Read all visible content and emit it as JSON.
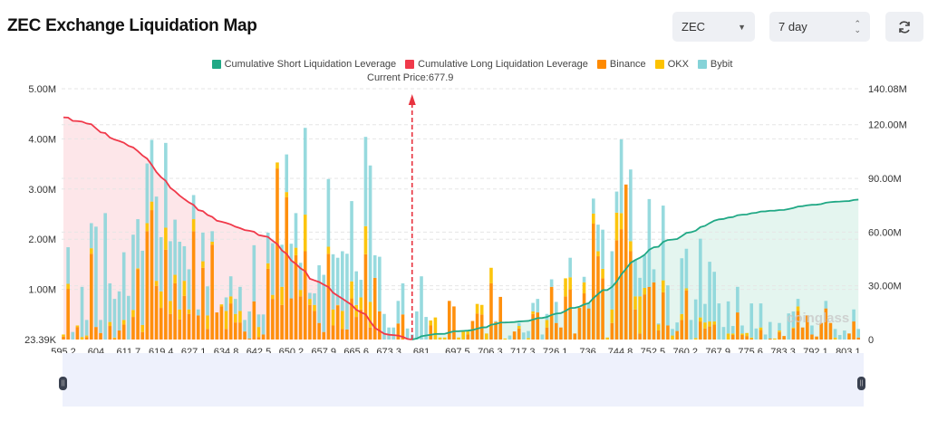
{
  "header": {
    "title": "ZEC Exchange Liquidation Map",
    "coin_select": {
      "value": "ZEC",
      "icon": "caret-down-icon"
    },
    "range_select": {
      "value": "7 day",
      "icon": "up-down-chevron-icon"
    },
    "refresh_icon": "refresh-icon"
  },
  "watermark": "coinglass",
  "slider": {
    "start": 0,
    "end": 1
  },
  "chart_data": {
    "type": "bar",
    "stacked": true,
    "current_price_label": "Current Price:677.9",
    "current_price": 677.9,
    "legend": [
      {
        "name": "Cumulative Short Liquidation Leverage",
        "color": "#20a885"
      },
      {
        "name": "Cumulative Long Liquidation Leverage",
        "color": "#f0394a"
      },
      {
        "name": "Binance",
        "color": "#ff8a00"
      },
      {
        "name": "OKX",
        "color": "#fcc200"
      },
      {
        "name": "Bybit",
        "color": "#85d3d8"
      }
    ],
    "legend_position": "top",
    "grid": true,
    "x_tick_labels": [
      "595.2",
      "604",
      "611.7",
      "619.4",
      "627.1",
      "634.8",
      "642.5",
      "650.2",
      "657.9",
      "665.6",
      "673.3",
      "681",
      "697.5",
      "706.3",
      "717.3",
      "726.1",
      "736",
      "744.8",
      "752.5",
      "760.2",
      "767.9",
      "775.6",
      "783.3",
      "792.1",
      "803.1"
    ],
    "y_left": {
      "ticks": [
        "23.39K",
        "1.00M",
        "2.00M",
        "3.00M",
        "4.00M",
        "5.00M"
      ],
      "range_millions": [
        0,
        5
      ]
    },
    "y_right": {
      "ticks": [
        "0",
        "30.00M",
        "60.00M",
        "90.00M",
        "120.00M",
        "140.08M"
      ],
      "range_millions": [
        0,
        140.08
      ]
    },
    "units": "millions USD",
    "current_price_bar_index": 75,
    "series": [
      {
        "name": "Binance",
        "values": [
          0.06,
          1.01,
          0,
          0.25,
          0,
          0.05,
          1.71,
          0.25,
          0.13,
          0,
          0.27,
          0.02,
          0.18,
          0.3,
          0,
          0.45,
          1.4,
          0.15,
          2.16,
          2.58,
          1.07,
          0.63,
          1.79,
          0.51,
          1.12,
          0.4,
          0.87,
          0.51,
          2.16,
          0.48,
          1.43,
          0.21,
          1.89,
          0.54,
          0.66,
          0.21,
          0.72,
          0.34,
          0.34,
          0.16,
          0.02,
          0.76,
          0.05,
          0.1,
          1.41,
          0.81,
          3.41,
          0.69,
          2.84,
          0.82,
          1.68,
          0.86,
          1.76,
          0.69,
          0.57,
          0.33,
          0.15,
          1.71,
          0.28,
          0.68,
          0.21,
          0.2,
          0.82,
          0.45,
          0.6,
          1.7,
          0.24,
          1.23,
          0.56,
          0,
          0,
          0,
          0.32,
          0.5,
          0,
          0,
          0,
          0,
          0,
          0.28,
          0,
          0,
          0,
          0.77,
          0.66,
          0,
          0,
          0.1,
          0.37,
          0.52,
          0.5,
          0,
          1.12,
          0.35,
          0.85,
          0,
          0,
          0.16,
          0.22,
          0,
          0,
          0.51,
          0.54,
          0,
          0.24,
          1.05,
          0.33,
          0.24,
          0.86,
          1.0,
          0.12,
          0.63,
          0.92,
          0.62,
          2.31,
          1.66,
          1.22,
          0,
          0.33,
          1.98,
          2.2,
          3.09,
          1.76,
          0.6,
          0.12,
          0.9,
          1.05,
          1.14,
          0.18,
          0.94,
          0.28,
          0,
          0.17,
          0.39,
          0.98,
          0,
          0,
          0.36,
          0.22,
          0.26,
          0.3,
          0,
          0,
          0,
          0.09,
          0.54,
          0.09,
          0.07,
          0.02,
          0,
          0.19,
          0,
          0.02,
          0,
          0.15,
          0.07,
          0,
          0.22,
          0.57,
          0.24,
          0.48,
          0.1,
          0.06,
          0.33,
          0.62,
          0.33,
          0,
          0,
          0,
          0.12,
          0.36,
          0.04
        ]
      },
      {
        "name": "OKX",
        "values": [
          0.04,
          0.1,
          0,
          0.03,
          0.05,
          0.03,
          0.11,
          0,
          0,
          0,
          0.08,
          0.02,
          0,
          0.09,
          0,
          0.14,
          0.02,
          0.14,
          0.16,
          0.17,
          0.1,
          0.33,
          0.44,
          0.26,
          0.17,
          0.2,
          0.3,
          0.09,
          0.24,
          0,
          0.13,
          0.27,
          0.06,
          0,
          0.04,
          0.36,
          0.14,
          0.17,
          0.23,
          0,
          0,
          0,
          0.2,
          0,
          0.11,
          0.08,
          0.12,
          0.36,
          0.1,
          0,
          0.15,
          0.13,
          0.73,
          0.12,
          0.12,
          0,
          0,
          0.14,
          0.32,
          0.01,
          0.36,
          0,
          0.34,
          0.24,
          0.24,
          0.56,
          0.51,
          0,
          0,
          0,
          0,
          0,
          0,
          0,
          0,
          0,
          0,
          0,
          0,
          0.1,
          0.44,
          0.04,
          0.04,
          0,
          0,
          0.04,
          0.16,
          0.06,
          0,
          0.19,
          0.19,
          0.12,
          0.31,
          0,
          0,
          0.02,
          0,
          0,
          0.05,
          0,
          0.03,
          0.05,
          0,
          0,
          0.15,
          0,
          0,
          0,
          0.36,
          0.24,
          0,
          0,
          0.22,
          0,
          0.2,
          0.1,
          0.19,
          0.04,
          0.27,
          0.55,
          0.32,
          0,
          0.2,
          0.26,
          0.74,
          0.13,
          0,
          0,
          0.12,
          0.24,
          0,
          0.08,
          0,
          0.12,
          0.04,
          0,
          0.03,
          0.08,
          0.12,
          0.1,
          0.06,
          0,
          0,
          0.12,
          0.03,
          0,
          0.03,
          0.06,
          0.02,
          0,
          0.05,
          0,
          0,
          0.02,
          0.03,
          0,
          0,
          0.02,
          0.09,
          0,
          0,
          0,
          0,
          0,
          0,
          0,
          0.04,
          0,
          0,
          0,
          0,
          0
        ]
      },
      {
        "name": "Bybit",
        "values": [
          0,
          0.73,
          0.15,
          0,
          1.0,
          0.31,
          0.5,
          2.0,
          0.26,
          2.52,
          0.77,
          0.77,
          0.78,
          1.35,
          0.87,
          1.5,
          0.98,
          1.48,
          1.19,
          1.23,
          1.68,
          1.08,
          1.69,
          1.19,
          1.1,
          1.35,
          0.69,
          0.8,
          0.48,
          0.12,
          0.57,
          0.58,
          0.21,
          0,
          0,
          0.27,
          0.4,
          0.3,
          0.48,
          0.23,
          0.54,
          1.12,
          0.25,
          0.4,
          0.61,
          1.03,
          0,
          0.84,
          0.75,
          1.09,
          0.69,
          0.54,
          1.73,
          0.12,
          0.23,
          1.15,
          1.14,
          1.35,
          1.1,
          0.94,
          1.19,
          1.51,
          1.6,
          0.67,
          0.35,
          1.78,
          2.72,
          0.45,
          1.09,
          0.51,
          0.24,
          0.24,
          0.45,
          0.62,
          0.22,
          0.1,
          0.56,
          1.26,
          0.45,
          0,
          0,
          0,
          0,
          0,
          0,
          0,
          0,
          0,
          0,
          0,
          0,
          0,
          0,
          0.02,
          0,
          0,
          0.08,
          0,
          0.06,
          0.14,
          0.14,
          0.17,
          0.27,
          0.1,
          0.12,
          0.15,
          0.42,
          0,
          0,
          0.39,
          0,
          0,
          0.11,
          0.1,
          0.3,
          0.53,
          0.78,
          0,
          1.16,
          0.42,
          1.47,
          0,
          1.43,
          0.73,
          0.37,
          0.65,
          1.75,
          0.26,
          0.02,
          1.49,
          0.8,
          0.13,
          0.17,
          1.11,
          0.79,
          0.39,
          0.77,
          1.57,
          0.37,
          1.19,
          0.99,
          0.72,
          0.25,
          0.64,
          0.15,
          0.51,
          0.16,
          0,
          0.68,
          0.22,
          0.48,
          0.1,
          0.33,
          0,
          0.15,
          0,
          0.52,
          0.32,
          0.15,
          0,
          0,
          0.18,
          0,
          0,
          0.15,
          0,
          0.17,
          0.09,
          0.18,
          0,
          0.24,
          0.17
        ]
      }
    ],
    "fill_colors": {
      "long_area": "#fde6e9",
      "short_area": "#e4f5ef",
      "current_price_line": "#e8333f"
    }
  }
}
